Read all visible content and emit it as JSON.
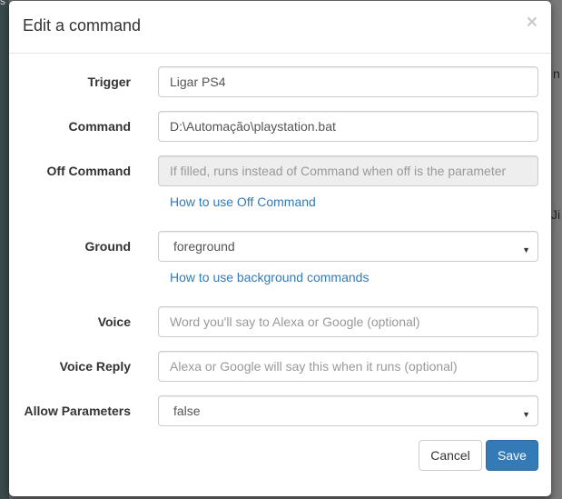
{
  "background": {
    "top_text": "s",
    "right_text_1": "n",
    "right_text_2": "Ji"
  },
  "modal": {
    "title": "Edit a command",
    "close_glyph": "×"
  },
  "fields": {
    "trigger": {
      "label": "Trigger",
      "value": "Ligar PS4"
    },
    "command": {
      "label": "Command",
      "value": "D:\\Automação\\playstation.bat"
    },
    "off_command": {
      "label": "Off Command",
      "placeholder": "If filled, runs instead of Command when off is the parameter",
      "help_link": "How to use Off Command"
    },
    "ground": {
      "label": "Ground",
      "selected": "foreground",
      "help_link": "How to use background commands"
    },
    "voice": {
      "label": "Voice",
      "placeholder": "Word you'll say to Alexa or Google (optional)"
    },
    "voice_reply": {
      "label": "Voice Reply",
      "placeholder": "Alexa or Google will say this when it runs (optional)"
    },
    "allow_parameters": {
      "label": "Allow Parameters",
      "selected": "false"
    }
  },
  "buttons": {
    "cancel": "Cancel",
    "save": "Save"
  },
  "icons": {
    "caret": "▼"
  },
  "colors": {
    "primary": "#337ab7",
    "link": "#337ab7"
  }
}
